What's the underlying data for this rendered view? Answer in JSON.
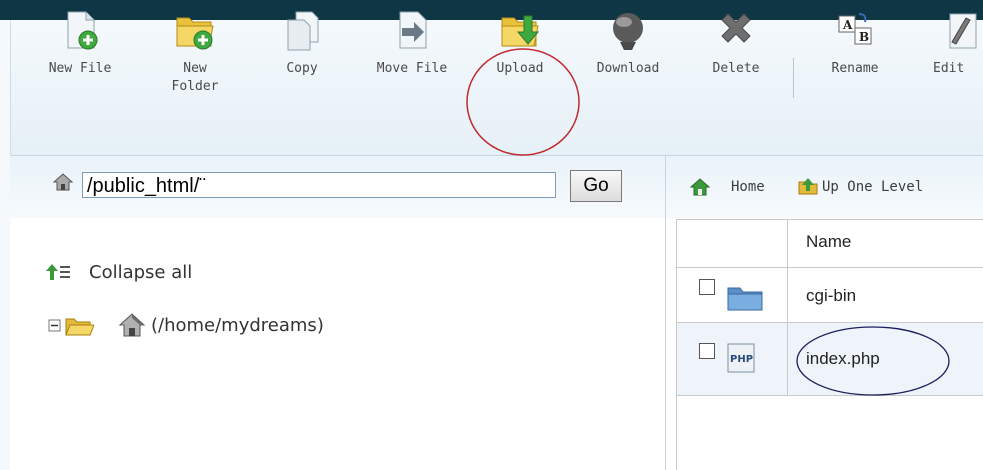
{
  "toolbar": {
    "items": [
      {
        "label": "New File",
        "icon": "new-file-icon"
      },
      {
        "label": "New\nFolder",
        "icon": "new-folder-icon"
      },
      {
        "label": "Copy",
        "icon": "copy-icon"
      },
      {
        "label": "Move File",
        "icon": "move-file-icon"
      },
      {
        "label": "Upload",
        "icon": "upload-icon"
      },
      {
        "label": "Download",
        "icon": "download-icon"
      },
      {
        "label": "Delete",
        "icon": "delete-icon"
      },
      {
        "label": "Rename",
        "icon": "rename-icon"
      },
      {
        "label": "Edit",
        "icon": "edit-icon"
      }
    ]
  },
  "path": {
    "value": "/public_html/¨",
    "go_label": "Go"
  },
  "tree": {
    "collapse_label": "Collapse all",
    "root_label": "(/home/mydreams)"
  },
  "nav": {
    "home_label": "Home",
    "up_label": "Up One Level"
  },
  "files": {
    "header_name": "Name",
    "rows": [
      {
        "name": "cgi-bin",
        "icon": "folder-icon"
      },
      {
        "name": "index.php",
        "icon": "php-file-icon"
      }
    ]
  },
  "colors": {
    "topbar": "#0f3645",
    "annotation_red": "#c0282d",
    "annotation_blue": "#1a1f5c"
  }
}
